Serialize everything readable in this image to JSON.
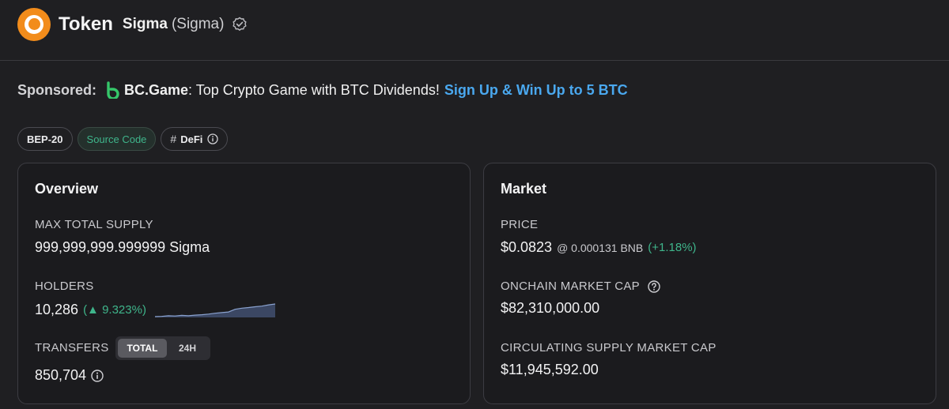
{
  "header": {
    "page_label": "Token",
    "token_name": "Sigma",
    "token_symbol": "(Sigma)"
  },
  "sponsored": {
    "label": "Sponsored:",
    "advertiser": "BC.Game",
    "text": ": Top Crypto Game with BTC Dividends!",
    "link": "Sign Up & Win Up to 5 BTC"
  },
  "tags": [
    {
      "label": "BEP-20"
    },
    {
      "label": "Source Code"
    },
    {
      "label": "DeFi",
      "prefix": "#"
    }
  ],
  "overview": {
    "title": "Overview",
    "max_supply_label": "MAX TOTAL SUPPLY",
    "max_supply_value": "999,999,999.999999 Sigma",
    "holders_label": "HOLDERS",
    "holders_value": "10,286",
    "holders_change": "(▲ 9.323%)",
    "holders_trend": [
      2,
      2.1,
      2.4,
      2.3,
      2.6,
      2.4,
      2.7,
      2.9,
      3.2,
      3.6,
      3.9,
      4.2,
      5.5,
      6.0,
      6.3,
      6.7,
      7.0,
      7.6,
      8.0
    ],
    "transfers_label": "TRANSFERS",
    "transfers_toggle": {
      "total": "TOTAL",
      "h24": "24H"
    },
    "transfers_value": "850,704"
  },
  "market": {
    "title": "Market",
    "price_label": "PRICE",
    "price_value": "$0.0823",
    "price_bnb": "@ 0.000131 BNB",
    "price_change": "(+1.18%)",
    "onchain_cap_label": "ONCHAIN MARKET CAP",
    "onchain_cap_value": "$82,310,000.00",
    "circ_cap_label": "CIRCULATING SUPPLY MARKET CAP",
    "circ_cap_value": "$11,945,592.00"
  },
  "colors": {
    "accent_link": "#4aa8ef",
    "positive": "#3fb58b",
    "brand_orange": "#f28c1b"
  }
}
